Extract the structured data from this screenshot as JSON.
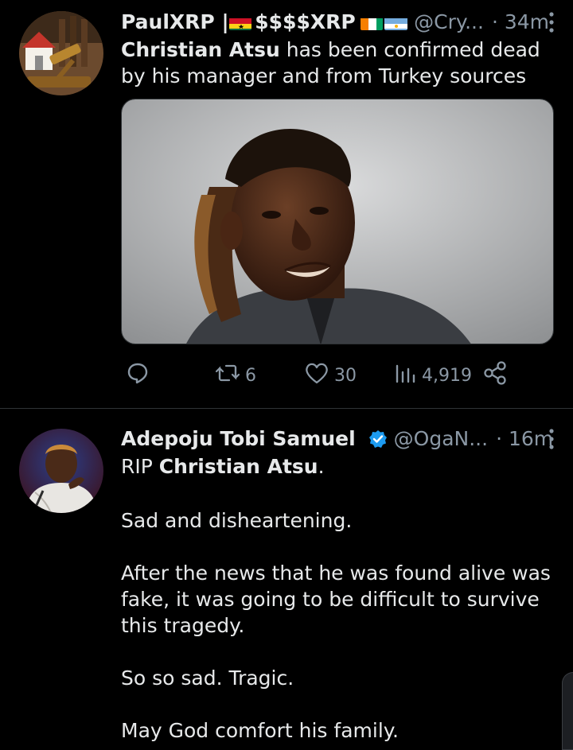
{
  "tweet1": {
    "display_name": "PaulXRP | ",
    "name_suffix": "$$$$XRP",
    "handle": "@Cry...",
    "time": "· 34m",
    "text_bold": "Christian Atsu",
    "text_rest": " has been confirmed dead by his manager and from Turkey sources",
    "stats": {
      "retweets": "6",
      "likes": "30",
      "views": "4,919"
    }
  },
  "tweet2": {
    "display_name": "Adepoju Tobi Samuel",
    "handle": "@OgaN...",
    "time": "· 16m",
    "line1_prefix": "RIP ",
    "line1_bold": "Christian Atsu",
    "line1_suffix": ".",
    "paragraphs": [
      "Sad and disheartening.",
      "After the news that he was found alive was fake, it was going to be difficult to survive this tragedy.",
      "So so sad. Tragic.",
      "May God comfort his family."
    ]
  },
  "colors": {
    "background": "#000000",
    "text": "#e7e9ea",
    "muted": "#8b98a5",
    "verified": "#1d9bf0"
  },
  "icons": [
    "reply-icon",
    "retweet-icon",
    "like-icon",
    "views-icon",
    "share-icon",
    "more-icon",
    "verified-icon"
  ]
}
